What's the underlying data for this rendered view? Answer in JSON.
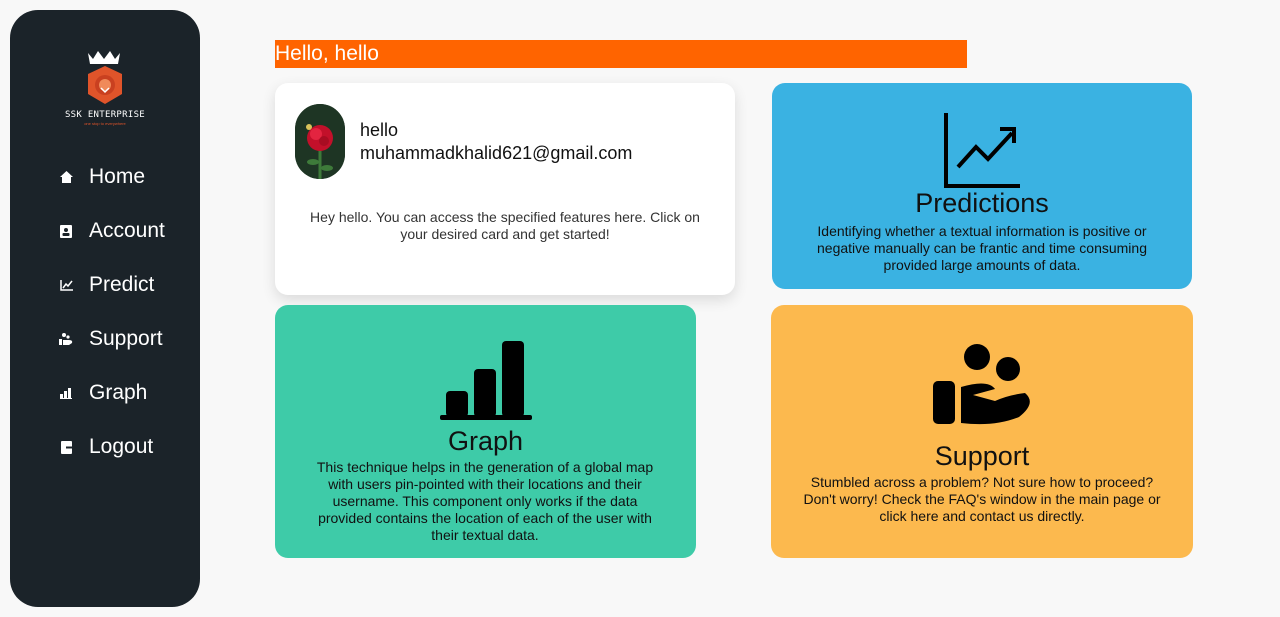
{
  "brand": {
    "name": "SSK ENTERPRISE",
    "tagline": "one stop to everywhere"
  },
  "nav": [
    {
      "label": "Home",
      "icon": "home-icon"
    },
    {
      "label": "Account",
      "icon": "account-icon"
    },
    {
      "label": "Predict",
      "icon": "chart-line-icon"
    },
    {
      "label": "Support",
      "icon": "support-icon"
    },
    {
      "label": "Graph",
      "icon": "bar-chart-icon"
    },
    {
      "label": "Logout",
      "icon": "logout-icon"
    }
  ],
  "header": {
    "greeting": "Hello, hello"
  },
  "profile": {
    "name": "hello",
    "email": "muhammadkhalid621@gmail.com",
    "message": "Hey hello. You can access the specified features here. Click on your desired card and get started!"
  },
  "cards": {
    "predictions": {
      "title": "Predictions",
      "description": "Identifying whether a textual information is positive or negative manually can be frantic and time consuming provided large amounts of data.",
      "color": "#3ab2e2"
    },
    "graph": {
      "title": "Graph",
      "description": "This technique helps in the generation of a global map with users pin-pointed with their locations and their username. This component only works if the data provided contains the location of each of the user with their textual data.",
      "color": "#3ecba8"
    },
    "support": {
      "title": "Support",
      "description": "Stumbled across a problem? Not sure how to proceed? Don't worry! Check the FAQ's window in the main page or click here and contact us directly.",
      "color": "#fcb94e"
    }
  },
  "colors": {
    "sidebar": "#1b2329",
    "accent": "#ff6400"
  }
}
